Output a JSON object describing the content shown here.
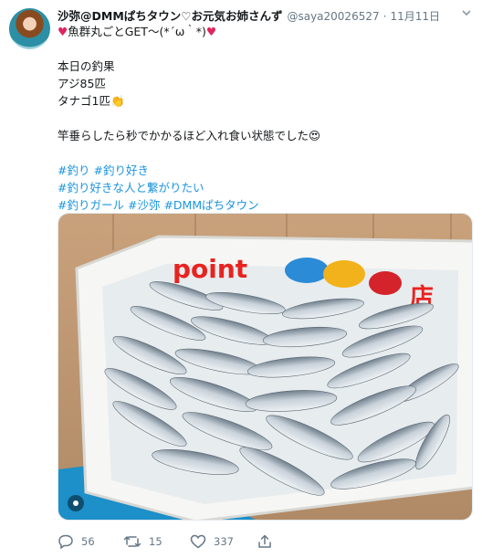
{
  "tweet": {
    "display_name": "沙弥@DMMぱちタウン♡お元気お姉さんず",
    "handle": "@saya20026527",
    "separator": "·",
    "timestamp": "11月11日",
    "lines": {
      "l1_heart_left": "♥",
      "l1_text": "魚群丸ごとGET〜(*´ω｀*)",
      "l1_heart_right": "♥",
      "l2": "本日の釣果",
      "l3": "アジ85匹",
      "l4_text": "タナゴ1匹",
      "l4_emoji": "👏",
      "l5_text": "竿垂らしたら秒でかかるほど入れ食い状態でした",
      "l5_emoji": "😍"
    },
    "hashtags": {
      "h1": "#釣り",
      "h2": "#釣り好き",
      "h3": "#釣り好きな人と繋がりたい",
      "h4": "#釣りガール",
      "h5": "#沙弥",
      "h6": "#DMMぱちタウン"
    },
    "photo_sign": {
      "left_text": "point",
      "right_text": "店"
    },
    "actions": {
      "reply_count": "56",
      "retweet_count": "15",
      "like_count": "337"
    },
    "colors": {
      "link": "#1b95e0",
      "heart": "#e0245e",
      "secondary_text": "#657786"
    },
    "icons": {
      "more": "chevron-down-icon",
      "reply": "reply-icon",
      "retweet": "retweet-icon",
      "like": "heart-icon",
      "share": "share-icon"
    }
  }
}
